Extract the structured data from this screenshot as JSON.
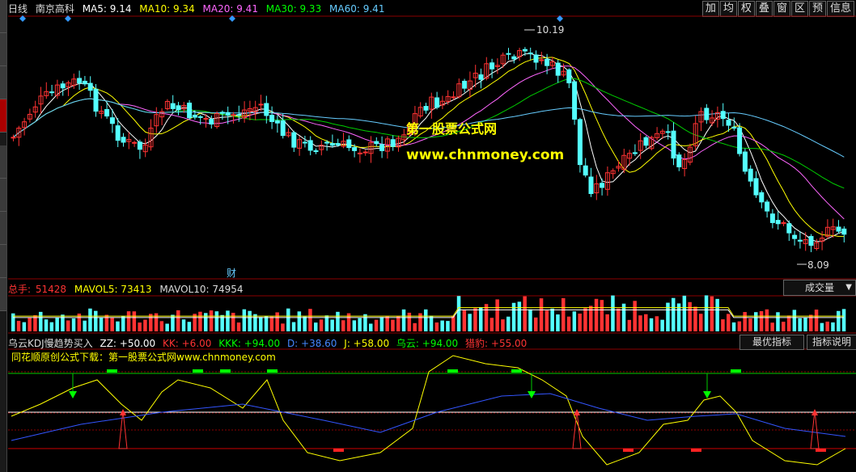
{
  "header": {
    "period": "日线",
    "stock_name": "南京高科",
    "ma": [
      {
        "label": "MA5: 9.14",
        "color": "#ffffff"
      },
      {
        "label": "MA10: 9.34",
        "color": "#ffff00"
      },
      {
        "label": "MA20: 9.41",
        "color": "#ff66ff"
      },
      {
        "label": "MA30: 9.33",
        "color": "#00ff00"
      },
      {
        "label": "MA60: 9.41",
        "color": "#66ccff"
      }
    ]
  },
  "toolbar": [
    "加",
    "均",
    "权",
    "叠",
    "窗",
    "区",
    "预",
    "信息"
  ],
  "price_chart": {
    "high_label": "10.19",
    "low_label": "8.09",
    "event_marker": "财",
    "watermark_title": "第一股票公式网",
    "watermark_url": "www.chnmoney.com"
  },
  "volume_panel": {
    "total_label": "总手:",
    "total_value": "51428",
    "mavol5": "MAVOL5: 73413",
    "mavol10": "MAVOL10: 74954",
    "select_value": "成交量"
  },
  "indicator_panel": {
    "name": "乌云KDJ慢趋势买入",
    "values": [
      {
        "label": "ZZ: +50.00",
        "color": "#ffffff"
      },
      {
        "label": "KK: +6.00",
        "color": "#ff3333"
      },
      {
        "label": "KKK: +94.00",
        "color": "#00ff00"
      },
      {
        "label": "D: +38.60",
        "color": "#4488ff"
      },
      {
        "label": "J: +58.00",
        "color": "#ffff00"
      },
      {
        "label": "乌云: +94.00",
        "color": "#00ff00"
      },
      {
        "label": "猎豹: +55.00",
        "color": "#ff3333"
      }
    ],
    "note": "同花顺原创公式下载：第一股票公式网www.chnmoney.com",
    "button_best": "最优指标",
    "button_desc": "指标说明"
  },
  "colors": {
    "up_candle": "#ff3333",
    "down_candle": "#54ffff",
    "ma5": "#ffffff",
    "ma10": "#ffff00",
    "ma20": "#ff66ff",
    "ma30": "#00cc00",
    "ma60": "#66ccff",
    "separator": "#8b0000"
  }
}
